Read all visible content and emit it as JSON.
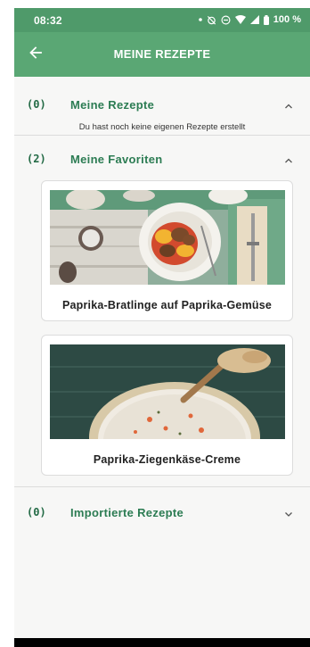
{
  "status_bar": {
    "time": "08:32",
    "battery": "100 %"
  },
  "app_bar": {
    "title": "MEINE REZEPTE",
    "back_icon": "arrow-left-icon"
  },
  "sections": [
    {
      "count": "(0)",
      "title": "Meine Rezepte",
      "expanded": true,
      "empty_text": "Du hast noch keine eigenen Rezepte erstellt"
    },
    {
      "count": "(2)",
      "title": "Meine Favoriten",
      "expanded": true,
      "recipes": [
        {
          "title": "Paprika-Bratlinge auf Paprika-Gemüse"
        },
        {
          "title": "Paprika-Ziegenkäse-Creme"
        }
      ]
    },
    {
      "count": "(0)",
      "title": "Importierte Rezepte",
      "expanded": false
    }
  ],
  "colors": {
    "status_bar": "#4f9a6a",
    "app_bar": "#5aa774",
    "section_title": "#2c7c53"
  }
}
